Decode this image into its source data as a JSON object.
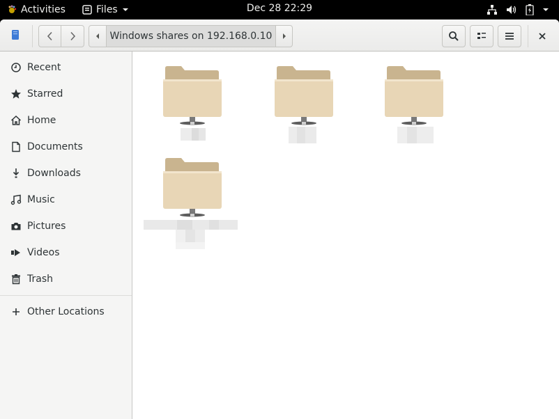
{
  "top_bar": {
    "activities_label": "Activities",
    "app_menu_label": "Files",
    "clock": "Dec 28  22:29",
    "icons": [
      "network-icon",
      "volume-icon",
      "battery-icon",
      "system-menu-icon"
    ]
  },
  "header": {
    "path_label": "Windows shares on 192.168.0.10",
    "buttons": [
      "back",
      "forward",
      "search",
      "view-toggle",
      "menu",
      "close"
    ]
  },
  "sidebar": {
    "items": [
      {
        "label": "Recent",
        "icon": "clock-icon"
      },
      {
        "label": "Starred",
        "icon": "star-icon"
      },
      {
        "label": "Home",
        "icon": "home-icon"
      },
      {
        "label": "Documents",
        "icon": "document-icon"
      },
      {
        "label": "Downloads",
        "icon": "download-icon"
      },
      {
        "label": "Music",
        "icon": "music-icon"
      },
      {
        "label": "Pictures",
        "icon": "camera-icon"
      },
      {
        "label": "Videos",
        "icon": "video-icon"
      },
      {
        "label": "Trash",
        "icon": "trash-icon"
      }
    ],
    "other_locations_label": "Other Locations"
  },
  "content": {
    "shares": [
      {
        "name": "",
        "redacted": true
      },
      {
        "name": "",
        "redacted": true
      },
      {
        "name": "",
        "redacted": true
      },
      {
        "name": "",
        "redacted": true
      }
    ]
  },
  "colors": {
    "folder_body": "#e8d6b6",
    "folder_tab": "#c9b48f",
    "sidebar_bg": "#f5f5f4",
    "header_bg": "#ebebea",
    "top_bar_bg": "#000000"
  }
}
